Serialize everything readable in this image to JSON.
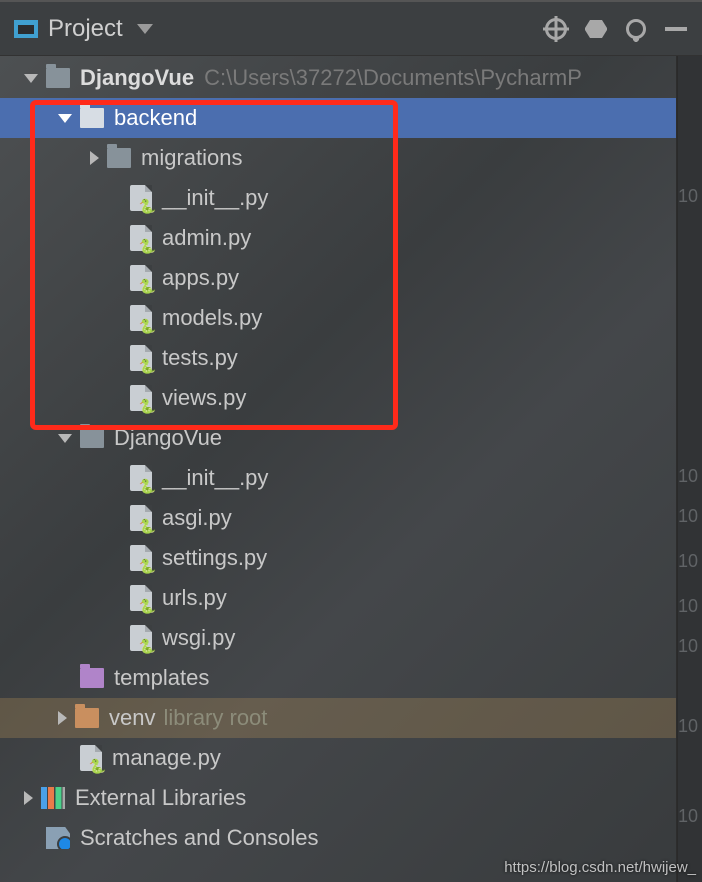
{
  "topbar": {
    "project_label": "Project"
  },
  "tree": {
    "root": {
      "name": "DjangoVue",
      "path": "C:\\Users\\37272\\Documents\\PycharmP"
    },
    "backend": {
      "name": "backend",
      "migrations": "migrations",
      "files": [
        "__init__.py",
        "admin.py",
        "apps.py",
        "models.py",
        "tests.py",
        "views.py"
      ]
    },
    "djangovue": {
      "name": "DjangoVue",
      "files": [
        "__init__.py",
        "asgi.py",
        "settings.py",
        "urls.py",
        "wsgi.py"
      ]
    },
    "templates": "templates",
    "venv": {
      "name": "venv",
      "suffix": "library root"
    },
    "manage": "manage.py",
    "external": "External Libraries",
    "scratches": "Scratches and Consoles"
  },
  "gutter_numbers": [
    "1",
    "1",
    "1",
    "1",
    "1",
    "1",
    "1",
    "1"
  ],
  "gutter_prefix": "10",
  "watermark": "https://blog.csdn.net/hwijew_"
}
